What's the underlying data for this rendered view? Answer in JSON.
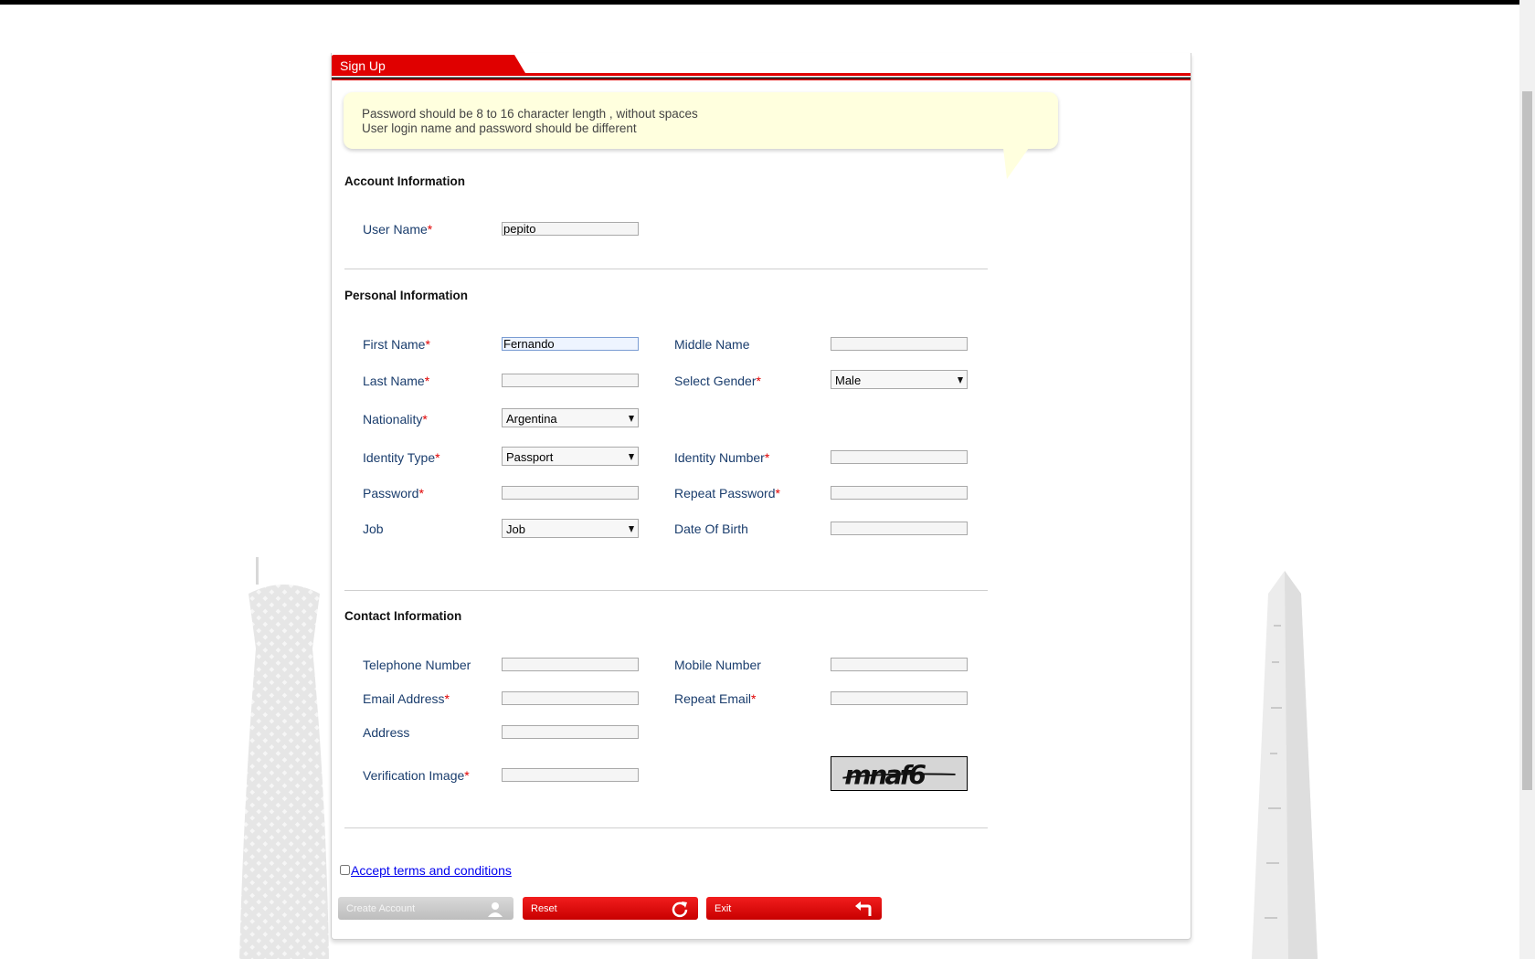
{
  "colors": {
    "accent": "#e00000",
    "label": "#1a3d6d",
    "tip_bg": "#ffffde"
  },
  "tab": {
    "title": "Sign Up"
  },
  "tip": {
    "line1": "Password should be 8 to 16 character length , without spaces",
    "line2": "User login name and password should be different"
  },
  "sections": {
    "account": "Account Information",
    "personal": "Personal Information",
    "contact": "Contact Information"
  },
  "fields": {
    "user_name": {
      "label": "User Name",
      "value": "pepito"
    },
    "first_name": {
      "label": "First Name",
      "value": "Fernando"
    },
    "middle_name": {
      "label": "Middle Name",
      "value": ""
    },
    "last_name": {
      "label": "Last Name",
      "value": ""
    },
    "gender": {
      "label": "Select Gender",
      "value": "Male"
    },
    "nationality": {
      "label": "Nationality",
      "value": "Argentina"
    },
    "identity_type": {
      "label": "Identity Type",
      "value": "Passport"
    },
    "identity_number": {
      "label": "Identity Number",
      "value": ""
    },
    "password": {
      "label": "Password",
      "value": ""
    },
    "repeat_password": {
      "label": "Repeat Password",
      "value": ""
    },
    "job": {
      "label": "Job",
      "value": "Job"
    },
    "date_of_birth": {
      "label": "Date Of Birth",
      "value": ""
    },
    "telephone": {
      "label": "Telephone Number",
      "value": ""
    },
    "mobile": {
      "label": "Mobile Number",
      "value": ""
    },
    "email": {
      "label": "Email Address",
      "value": ""
    },
    "repeat_email": {
      "label": "Repeat Email",
      "value": ""
    },
    "address": {
      "label": "Address",
      "value": ""
    },
    "verification": {
      "label": "Verification Image",
      "value": ""
    }
  },
  "required_marker": "*",
  "captcha_text": "mnaf6",
  "terms": {
    "label": "Accept terms and conditions"
  },
  "buttons": {
    "create": "Create Account",
    "reset": "Reset",
    "exit": "Exit"
  },
  "icons": {
    "create": "user-icon",
    "reset": "refresh-icon",
    "exit": "return-arrow-icon"
  }
}
